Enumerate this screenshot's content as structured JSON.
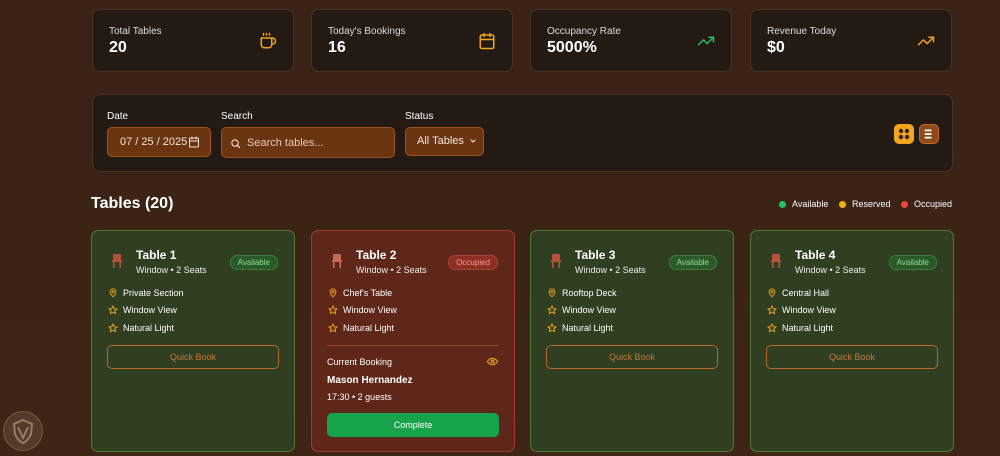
{
  "stats": [
    {
      "label": "Total Tables",
      "value": "20",
      "icon": "coffee-icon",
      "icon_color": "#f2a51d"
    },
    {
      "label": "Today's Bookings",
      "value": "16",
      "icon": "calendar-icon",
      "icon_color": "#f2a51d"
    },
    {
      "label": "Occupancy Rate",
      "value": "5000%",
      "icon": "trending-up-icon",
      "icon_color": "#22c55e"
    },
    {
      "label": "Revenue Today",
      "value": "$0",
      "icon": "trending-up-icon",
      "icon_color": "#f2a51d"
    }
  ],
  "filters": {
    "date_label": "Date",
    "date_value": "07 / 25 / 2025",
    "search_label": "Search",
    "search_placeholder": "Search tables...",
    "status_label": "Status",
    "status_value": "All Tables"
  },
  "section": {
    "title": "Tables (20)",
    "legend": [
      {
        "label": "Available",
        "color": "#22c55e"
      },
      {
        "label": "Reserved",
        "color": "#eab308"
      },
      {
        "label": "Occupied",
        "color": "#ef4444"
      }
    ]
  },
  "tables": [
    {
      "name": "Table 1",
      "subtitle": "Window • 2 Seats",
      "status": "Available",
      "features": [
        "Private Section",
        "Window View",
        "Natural Light"
      ],
      "action": "Quick Book"
    },
    {
      "name": "Table 2",
      "subtitle": "Window • 2 Seats",
      "status": "Occupied",
      "features": [
        "Chef's Table",
        "Window View",
        "Natural Light"
      ],
      "booking": {
        "label": "Current Booking",
        "guest": "Mason Hernandez",
        "info": "17:30 • 2 guests",
        "action": "Complete"
      }
    },
    {
      "name": "Table 3",
      "subtitle": "Window • 2 Seats",
      "status": "Available",
      "features": [
        "Rooftop Deck",
        "Window View",
        "Natural Light"
      ],
      "action": "Quick Book"
    },
    {
      "name": "Table 4",
      "subtitle": "Window • 2 Seats",
      "status": "Available",
      "features": [
        "Central Hall",
        "Window View",
        "Natural Light"
      ],
      "action": "Quick Book"
    }
  ]
}
